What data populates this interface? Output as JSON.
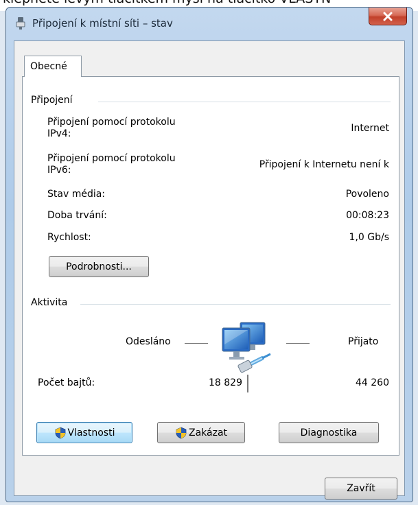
{
  "window": {
    "title": "Připojení k místní síti – stav",
    "partial_top_text": "klepněte levým tlačítkem myši na tlačítko VLASTN"
  },
  "tabs": [
    {
      "label": "Obecné"
    }
  ],
  "connection": {
    "group_title": "Připojení",
    "rows": [
      {
        "label": "Připojení pomocí protokolu\nIPv4:",
        "value": "Internet"
      },
      {
        "label": "Připojení pomocí protokolu\nIPv6:",
        "value": "Připojení k Internetu není k"
      },
      {
        "label": "Stav média:",
        "value": "Povoleno"
      },
      {
        "label": "Doba trvání:",
        "value": "00:08:23"
      },
      {
        "label": "Rychlost:",
        "value": "1,0 Gb/s"
      }
    ],
    "details_button": "Podrobnosti..."
  },
  "activity": {
    "group_title": "Aktivita",
    "sent_label": "Odesláno",
    "received_label": "Přijato",
    "bytes_label": "Počet bajtů:",
    "bytes_sent": "18 829",
    "bytes_received": "44 260",
    "icon": "network-computers-icon"
  },
  "buttons": {
    "properties": "Vlastnosti",
    "disable": "Zakázat",
    "diagnose": "Diagnostika",
    "close": "Zavřít"
  },
  "colors": {
    "accent_default_button": "#3c7fb1",
    "close_button_red": "#c2412b"
  }
}
